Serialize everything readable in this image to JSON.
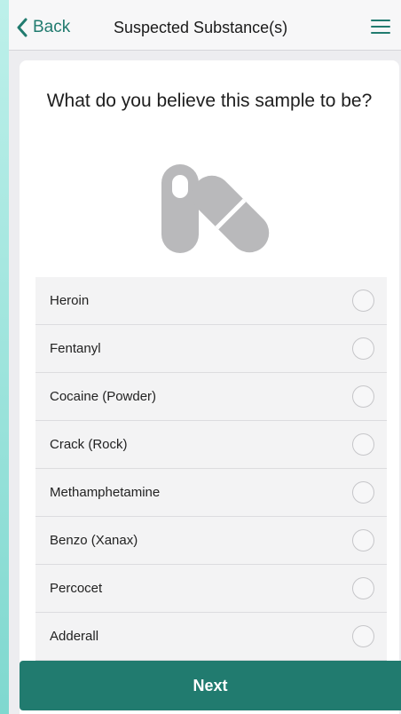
{
  "nav": {
    "back_label": "Back",
    "title": "Suspected Substance(s)"
  },
  "question": "What do you believe this sample to be?",
  "options": [
    {
      "label": "Heroin",
      "selected": false
    },
    {
      "label": "Fentanyl",
      "selected": false
    },
    {
      "label": "Cocaine (Powder)",
      "selected": false
    },
    {
      "label": "Crack (Rock)",
      "selected": false
    },
    {
      "label": "Methamphetamine",
      "selected": false
    },
    {
      "label": "Benzo (Xanax)",
      "selected": false
    },
    {
      "label": "Percocet",
      "selected": false
    },
    {
      "label": "Adderall",
      "selected": false
    }
  ],
  "next_label": "Next",
  "colors": {
    "accent": "#217b6f",
    "icon_gray": "#b9b9bb"
  },
  "icons": {
    "back": "chevron-left-icon",
    "menu": "hamburger-menu-icon",
    "hero": "pills-icon"
  }
}
